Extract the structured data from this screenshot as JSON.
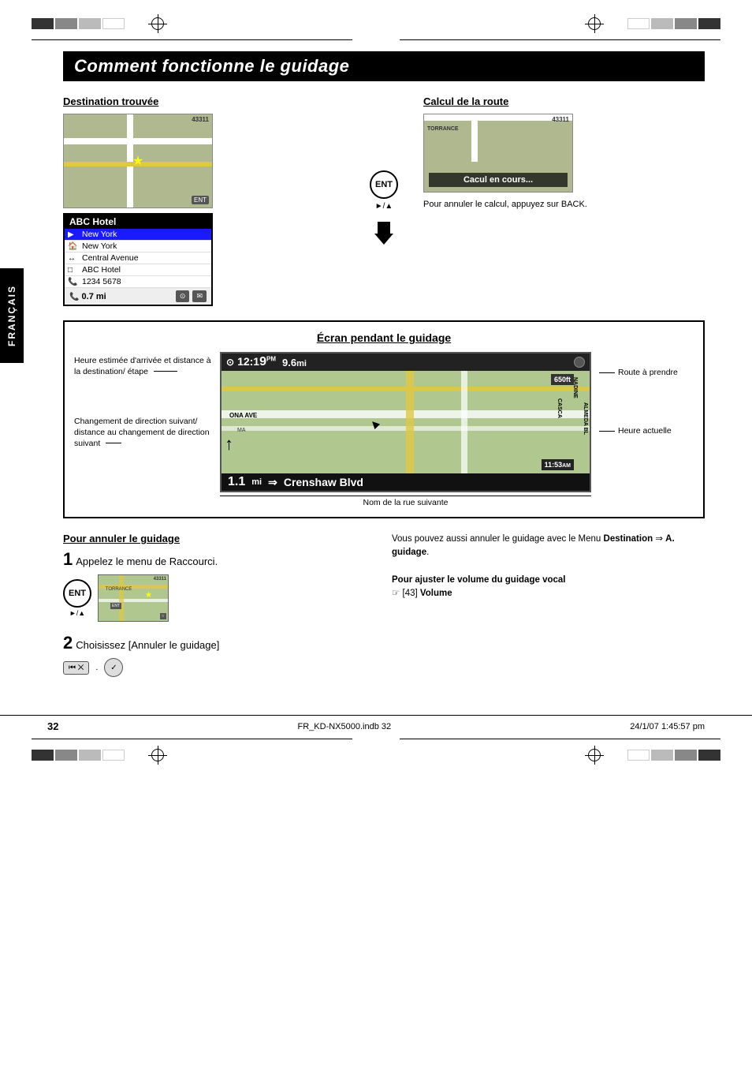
{
  "page": {
    "title": "Comment fonctionne le guidage",
    "page_number": "32",
    "file_info": "FR_KD-NX5000.indb  32",
    "date_info": "24/1/07  1:45:57 pm",
    "language": "FRANÇAIS"
  },
  "sections": {
    "destination_trouvee": {
      "heading": "Destination trouvée",
      "hotel_name": "ABC Hotel",
      "rows": [
        {
          "icon": "▶",
          "text": "New York",
          "selected": true
        },
        {
          "icon": "🏠",
          "text": "New York",
          "selected": false
        },
        {
          "icon": "↔",
          "text": "Central Avenue",
          "selected": false
        },
        {
          "icon": "□",
          "text": "ABC Hotel",
          "selected": false
        },
        {
          "icon": "📞",
          "text": "1234 5678",
          "selected": false
        }
      ],
      "distance": "0.7 mi"
    },
    "calcul_route": {
      "heading": "Calcul de la route",
      "overlay_text": "Cacul en cours...",
      "note": "Pour annuler le calcul, appuyez sur BACK."
    },
    "ecran_guidage": {
      "heading": "Écran pendant le guidage",
      "labels_left": [
        {
          "text": "Heure estimée d'arrivée et distance à la destination/ étape"
        },
        {
          "text": "Changement de direction suivant/ distance au changement de direction suivant"
        }
      ],
      "labels_right": [
        {
          "text": "Route à prendre"
        },
        {
          "text": "Heure actuelle"
        },
        {
          "text": "Nom de la rue suivante"
        }
      ],
      "nav_display": {
        "time": "12:19",
        "time_suffix": "PM",
        "distance": "9.6mi",
        "bottom_distance": "1.1 mi",
        "street_name": "Crenshaw Blvd",
        "current_time": "11:53",
        "current_time_suffix": "AM",
        "distance_badge": "650ft"
      }
    },
    "cancel_guidance": {
      "heading": "Pour annuler le guidage",
      "step1": {
        "number": "1",
        "text": "Appelez le menu de Raccourci."
      },
      "step2": {
        "number": "2",
        "text": "Choisissez [Annuler le guidage]"
      },
      "right_note": "Vous pouvez aussi annuler le guidage avec le Menu",
      "right_menu": "Destination",
      "right_arrow": "⇒",
      "right_item": "A. guidage",
      "right_item_prefix": "A.",
      "volume_heading": "Pour ajuster le volume du guidage vocal",
      "volume_ref": "☞ [43] Volume"
    },
    "ent_button": {
      "label": "ENT",
      "sublabel": "►/▲"
    }
  }
}
